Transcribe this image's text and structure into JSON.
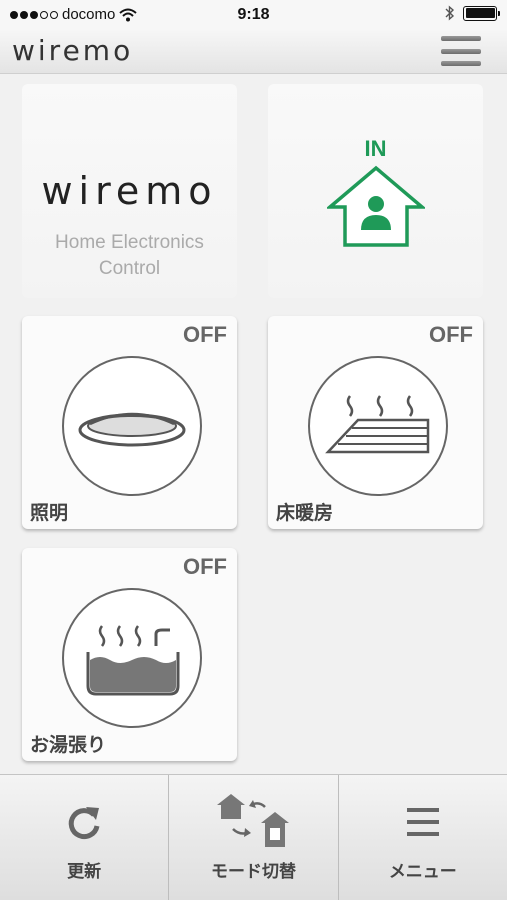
{
  "status_bar": {
    "carrier": "docomo",
    "time": "9:18",
    "signal_dots_filled": 3,
    "signal_dots_total": 5
  },
  "header": {
    "logo": "wiremo",
    "menu_icon": "hamburger-icon"
  },
  "tiles": {
    "brand": {
      "logo": "wiremo",
      "subtitle_line1": "Home Electronics",
      "subtitle_line2": "Control"
    },
    "presence": {
      "status": "IN",
      "icon": "house-person-icon",
      "accent": "#1f9a58"
    },
    "devices": [
      {
        "label": "照明",
        "status": "OFF",
        "icon": "ceiling-light-icon"
      },
      {
        "label": "床暖房",
        "status": "OFF",
        "icon": "floor-heating-icon"
      },
      {
        "label": "お湯張り",
        "status": "OFF",
        "icon": "bathtub-icon"
      }
    ]
  },
  "toolbar": {
    "items": [
      {
        "label": "更新",
        "icon": "refresh-icon"
      },
      {
        "label": "モード切替",
        "icon": "mode-switch-icon"
      },
      {
        "label": "メニュー",
        "icon": "menu-icon"
      }
    ]
  },
  "colors": {
    "accent_green": "#1f9a58",
    "status_text": "#666666",
    "background": "#f1f1f1"
  }
}
